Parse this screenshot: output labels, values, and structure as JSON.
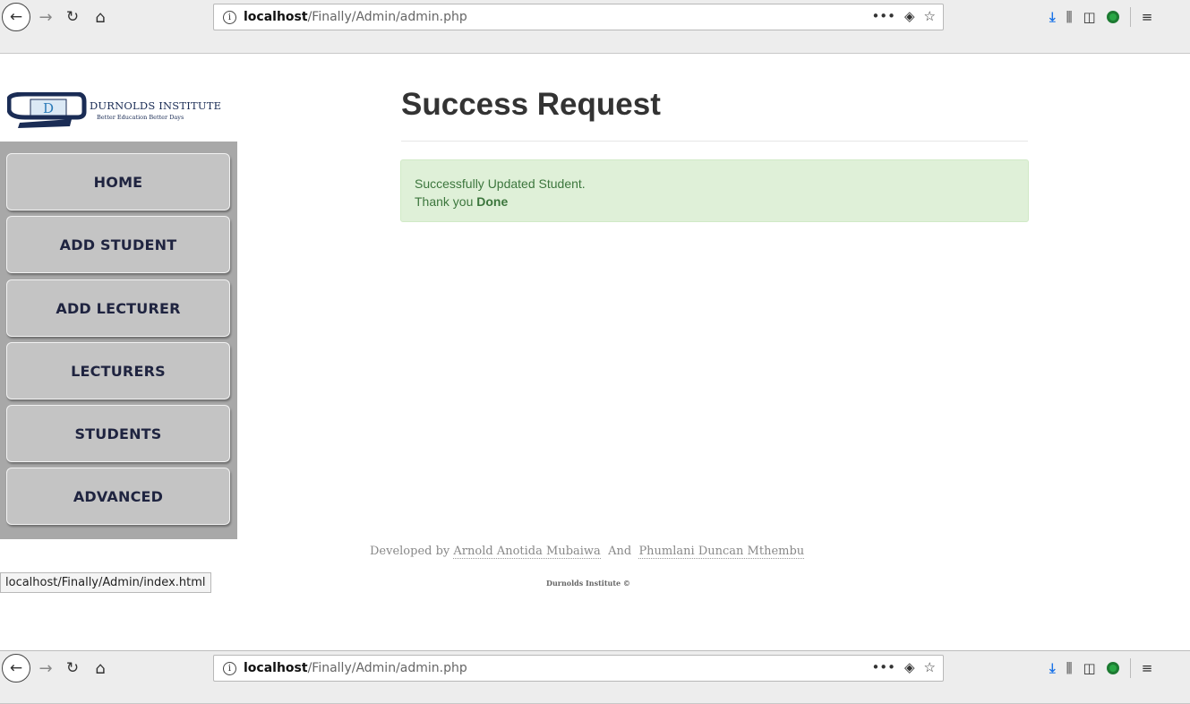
{
  "browser": {
    "url_host": "localhost",
    "url_path": "/Finally/Admin/admin.php"
  },
  "logo": {
    "title": "DURNOLDS INSTITUTE",
    "tagline": "Better Education Better Days",
    "letter": "D"
  },
  "sidebar": {
    "items": [
      {
        "label": "HOME"
      },
      {
        "label": "ADD STUDENT"
      },
      {
        "label": "ADD LECTURER"
      },
      {
        "label": "LECTURERS"
      },
      {
        "label": "STUDENTS"
      },
      {
        "label": "ADVANCED"
      }
    ]
  },
  "main": {
    "title": "Success Request",
    "alert_line1": "Successfully Updated Student.",
    "alert_line2_prefix": "Thank you",
    "alert_line2_strong": "Done"
  },
  "footer": {
    "developed_by": "Developed by",
    "author1": "Arnold Anotida Mubaiwa",
    "and": "And",
    "author2": "Phumlani Duncan Mthembu",
    "copyright": "Durnolds Institute   ©"
  },
  "status_bar": {
    "text": "localhost/Finally/Admin/index.html"
  },
  "colors": {
    "sidebar_bg": "#a8a8a8",
    "button_bg": "#c4c4c4",
    "alert_bg": "#dff0d8",
    "alert_text": "#3c763d"
  }
}
